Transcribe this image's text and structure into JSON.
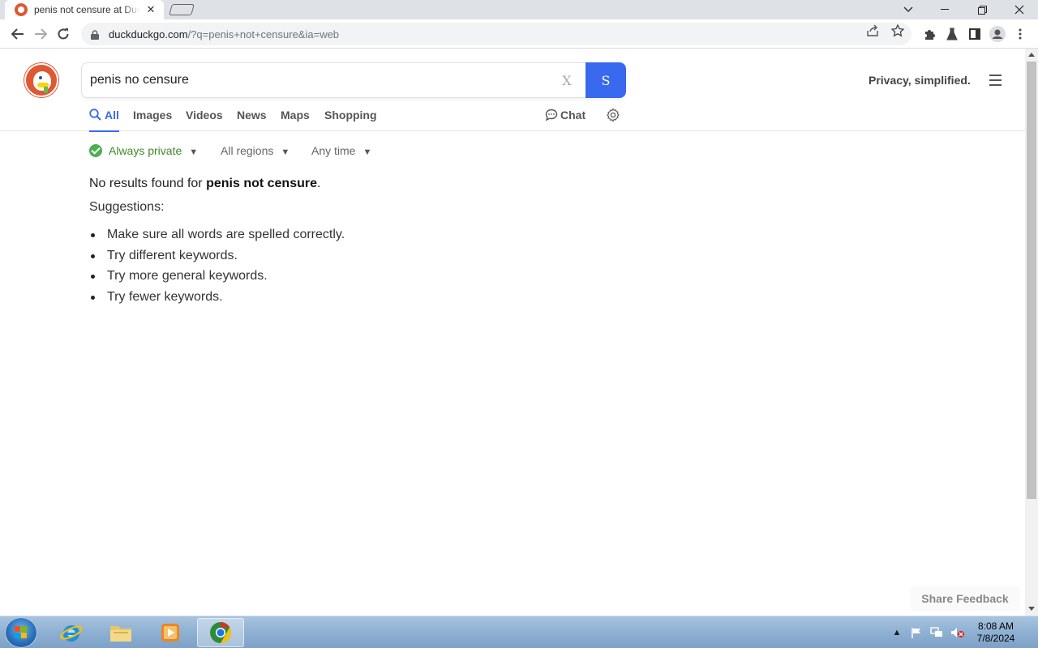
{
  "browser": {
    "tab_title": "penis not censure at DuckDuckGo",
    "url_host": "duckduckgo.com",
    "url_rest": "/?q=penis+not+censure&ia=web"
  },
  "search": {
    "query": "penis no censure",
    "clear_label": "X",
    "submit_label": "S"
  },
  "header": {
    "tagline": "Privacy, simplified."
  },
  "tabs": [
    {
      "label": "All",
      "active": true
    },
    {
      "label": "Images"
    },
    {
      "label": "Videos"
    },
    {
      "label": "News"
    },
    {
      "label": "Maps"
    },
    {
      "label": "Shopping"
    }
  ],
  "chat_label": "Chat",
  "filters": {
    "private": "Always private",
    "region": "All regions",
    "time": "Any time"
  },
  "results": {
    "no_results_prefix": "No results found for ",
    "no_results_query": "penis not censure",
    "no_results_suffix": ".",
    "suggestions_title": "Suggestions:",
    "suggestions": [
      "Make sure all words are spelled correctly.",
      "Try different keywords.",
      "Try more general keywords.",
      "Try fewer keywords."
    ]
  },
  "feedback_label": "Share Feedback",
  "taskbar": {
    "time": "8:08 AM",
    "date": "7/8/2024"
  },
  "colors": {
    "accent": "#3969ef",
    "ddg_orange": "#de5833",
    "private_green": "#4caf50"
  }
}
